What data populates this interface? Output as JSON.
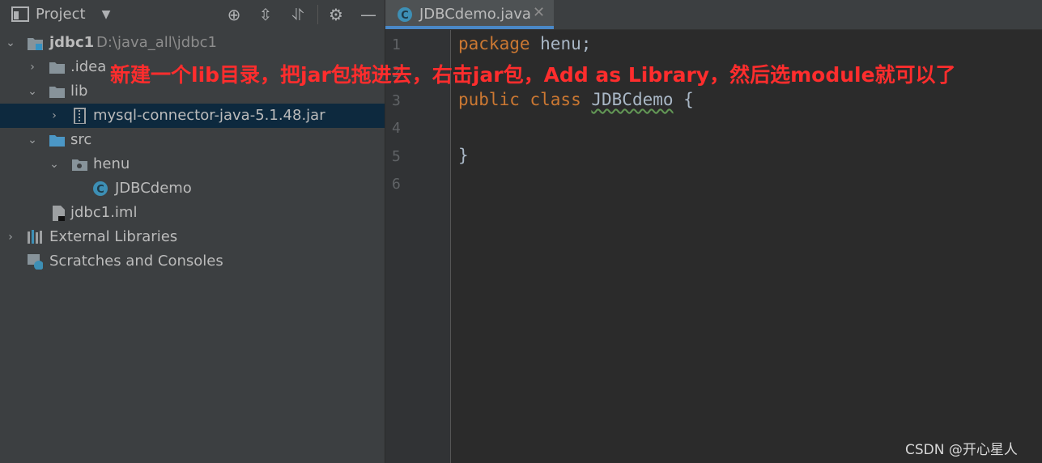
{
  "project_panel": {
    "title": "Project",
    "toolbar_icons": [
      "project-panel-icon",
      "dropdown-icon",
      "locate-icon",
      "expand-all-icon",
      "collapse-all-icon",
      "settings-gear-icon",
      "hide-minus-icon"
    ]
  },
  "tree": [
    {
      "label": "jdbc1",
      "hint": "D:\\java_all\\jdbc1",
      "icon": "module-folder-icon",
      "expanded": true
    },
    {
      "label": ".idea",
      "icon": "folder-icon",
      "expanded": false
    },
    {
      "label": "lib",
      "icon": "folder-icon",
      "expanded": true
    },
    {
      "label": "mysql-connector-java-5.1.48.jar",
      "icon": "jar-icon",
      "expanded": false,
      "selected": true
    },
    {
      "label": "src",
      "icon": "source-folder-icon",
      "expanded": true
    },
    {
      "label": "henu",
      "icon": "package-icon",
      "expanded": true
    },
    {
      "label": "JDBCdemo",
      "icon": "java-class-icon"
    },
    {
      "label": "jdbc1.iml",
      "icon": "iml-file-icon"
    },
    {
      "label": "External Libraries",
      "icon": "libraries-icon",
      "expanded": false
    },
    {
      "label": "Scratches and Consoles",
      "icon": "scratches-icon"
    }
  ],
  "editor": {
    "tab_label": "JDBCdemo.java",
    "line_numbers": [
      "1",
      "2",
      "3",
      "4",
      "5",
      "6"
    ],
    "code": {
      "line1_kw": "package",
      "line1_rest": " henu;",
      "line3_kw": "public class",
      "line3_class": "JDBCdemo",
      "line3_rest": " {",
      "line5": "}"
    }
  },
  "annotation": "新建一个lib目录，把jar包拖进去，右击jar包，Add as Library，然后选module就可以了",
  "watermark": "CSDN @开心星人",
  "colors": {
    "accent": "#4a88c7",
    "selection": "#0d293e",
    "keyword": "#cc7832",
    "annotation": "#ff2d2d"
  }
}
